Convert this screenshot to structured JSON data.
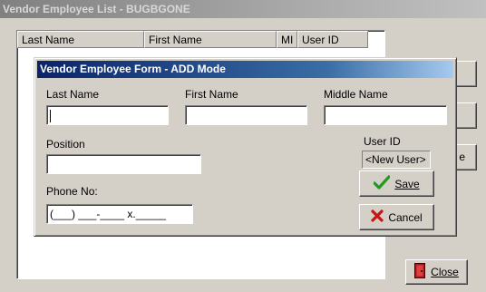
{
  "window": {
    "title": "Vendor Employee List - BUGBGONE"
  },
  "list": {
    "columns": [
      "Last Name",
      "First Name",
      "MI",
      "User ID"
    ]
  },
  "background_buttons": {
    "partial_label": "e",
    "close_label": "Close"
  },
  "dialog": {
    "title": "Vendor Employee Form - ADD Mode",
    "fields": {
      "last_name_label": "Last Name",
      "last_name_value": "",
      "first_name_label": "First Name",
      "first_name_value": "",
      "middle_name_label": "Middle Name",
      "middle_name_value": "",
      "position_label": "Position",
      "position_value": "",
      "phone_label": "Phone No:",
      "phone_value": "(___) ___-____ x._____",
      "user_id_label": "User ID",
      "user_id_value": "<New User>"
    },
    "buttons": {
      "save_label": "Save",
      "cancel_label": "Cancel"
    }
  },
  "icons": {
    "save": "checkmark-icon",
    "cancel": "x-icon",
    "close": "door-exit-icon"
  },
  "colors": {
    "dialog_title_start": "#0a246a",
    "dialog_title_end": "#a6caf0",
    "check_green": "#1f9a1f",
    "cancel_red": "#c81414",
    "close_red": "#b01818"
  }
}
